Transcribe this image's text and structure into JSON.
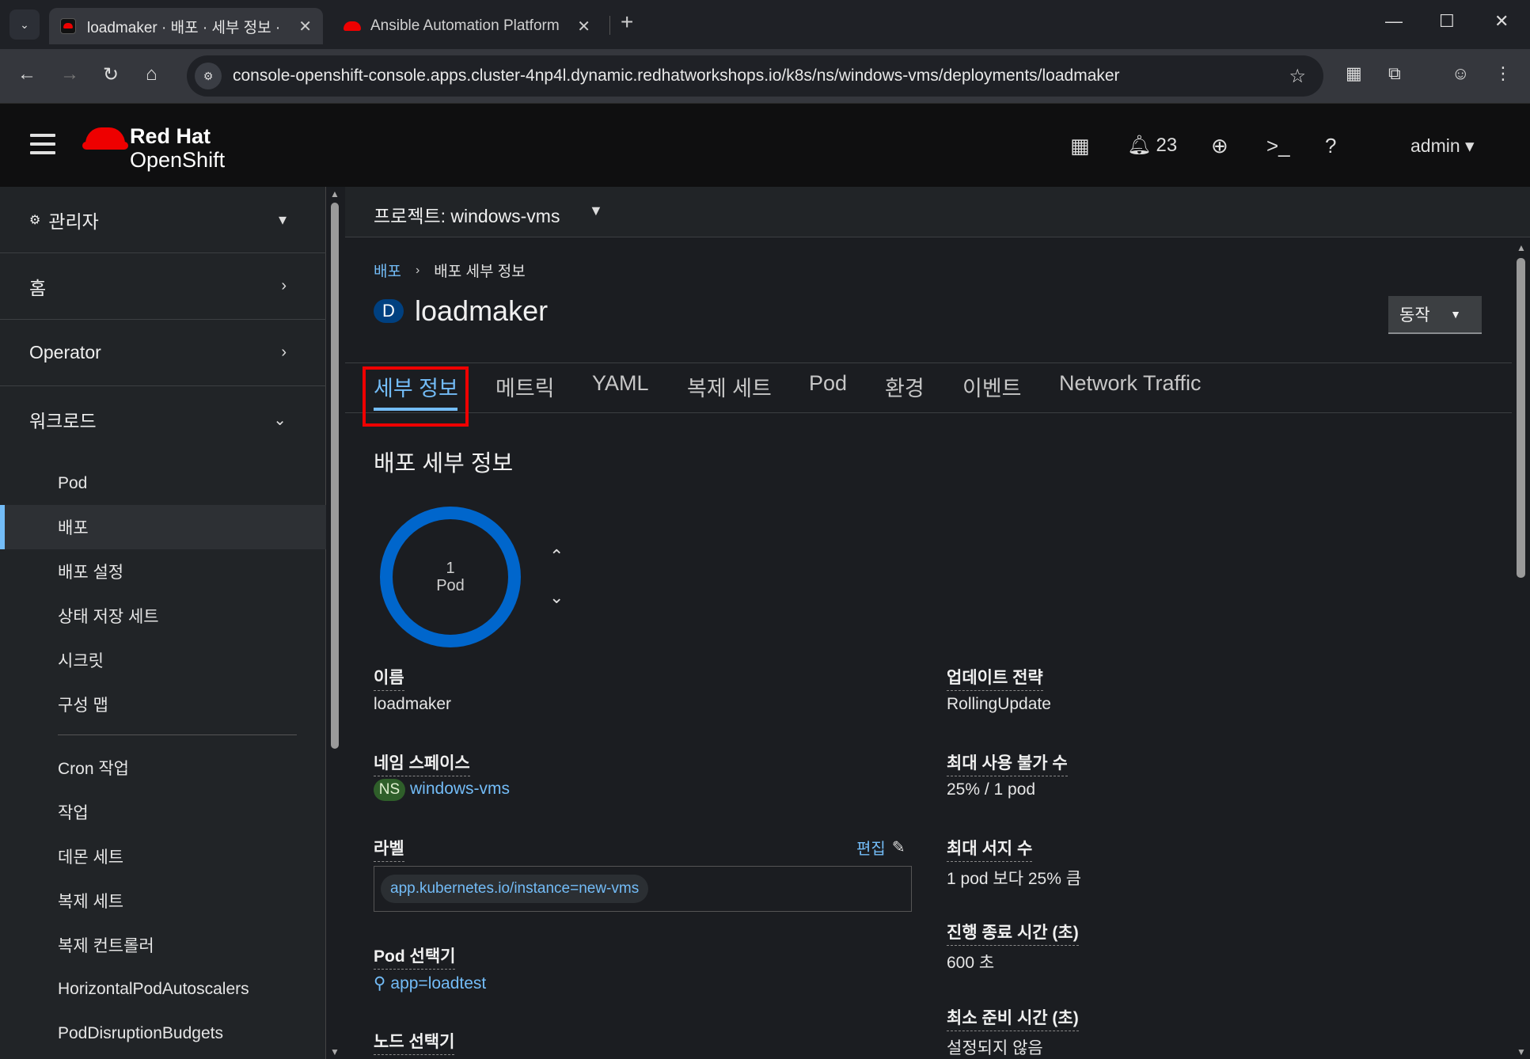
{
  "browser": {
    "tabs": [
      {
        "title": "loadmaker · 배포 · 세부 정보 ·",
        "active": true
      },
      {
        "title": "Ansible Automation Platform",
        "active": false
      }
    ],
    "url": "console-openshift-console.apps.cluster-4np4l.dynamic.redhatworkshops.io/k8s/ns/windows-vms/deployments/loadmaker"
  },
  "masthead": {
    "brand_line1": "Red Hat",
    "brand_line2": "OpenShift",
    "notifications_count": "23",
    "user": "admin"
  },
  "sidebar": {
    "perspective": "관리자",
    "sections": [
      {
        "label": "홈",
        "expanded": false
      },
      {
        "label": "Operator",
        "expanded": false
      },
      {
        "label": "워크로드",
        "expanded": true
      }
    ],
    "workload_items": [
      "Pod",
      "배포",
      "배포 설정",
      "상태 저장 세트",
      "시크릿",
      "구성 맵"
    ],
    "workload_items_2": [
      "Cron 작업",
      "작업",
      "데몬 세트",
      "복제 세트",
      "복제 컨트롤러",
      "HorizontalPodAutoscalers",
      "PodDisruptionBudgets"
    ],
    "active_item": "배포"
  },
  "project": {
    "label": "프로젝트: windows-vms"
  },
  "breadcrumb": {
    "parent": "배포",
    "current": "배포 세부 정보"
  },
  "resource": {
    "badge": "D",
    "name": "loadmaker",
    "actions_label": "동작"
  },
  "tabs": [
    "세부 정보",
    "메트릭",
    "YAML",
    "복제 세트",
    "Pod",
    "환경",
    "이벤트",
    "Network Traffic"
  ],
  "active_tab": "세부 정보",
  "details": {
    "section_title": "배포 세부 정보",
    "pod_count": "1",
    "pod_label": "Pod",
    "name_term": "이름",
    "name_value": "loadmaker",
    "namespace_term": "네임 스페이스",
    "namespace_badge": "NS",
    "namespace_value": "windows-vms",
    "labels_term": "라벨",
    "labels_edit": "편집",
    "labels": [
      "app.kubernetes.io/instance=new-vms"
    ],
    "pod_selector_term": "Pod 선택기",
    "pod_selector_value": "app=loadtest",
    "node_selector_term": "노드 선택기",
    "update_strategy_term": "업데이트 전략",
    "update_strategy_value": "RollingUpdate",
    "max_unavailable_term": "최대 사용 불가 수",
    "max_unavailable_value": "25% / 1 pod",
    "max_surge_term": "최대 서지 수",
    "max_surge_value": "1 pod 보다 25% 큼",
    "progress_deadline_term": "진행 종료 시간 (초)",
    "progress_deadline_value": "600 초",
    "min_ready_term": "최소 준비 시간 (초)",
    "min_ready_value": "설정되지 않음"
  },
  "colors": {
    "accent": "#73bcf7",
    "donut": "#0066cc",
    "highlight": "#ee0000"
  }
}
